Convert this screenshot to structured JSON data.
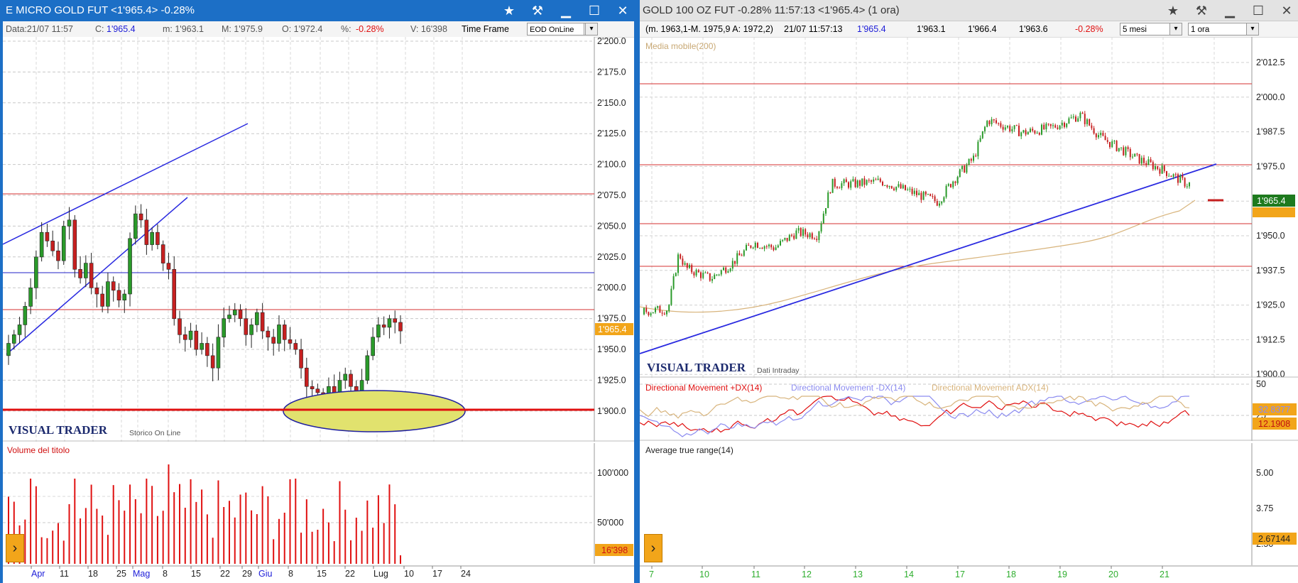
{
  "left": {
    "title": "E MICRO GOLD FUT <1'965.4> -0.28%",
    "info": {
      "data": "Data:21/07 11:57",
      "c_label": "C:",
      "c_value": "1'965.4",
      "m": "m: 1'963.1",
      "M": "M: 1'975.9",
      "O": "O: 1'972.4",
      "pct_label": "%:",
      "pct_value": "-0.28%",
      "V": "V: 16'398",
      "time_frame": "Time Frame",
      "mode": "EOD OnLine"
    },
    "price_ticks": [
      "2'200.0",
      "2'175.0",
      "2'150.0",
      "2'125.0",
      "2'100.0",
      "2'075.0",
      "2'050.0",
      "2'025.0",
      "2'000.0",
      "1'975.0",
      "1'950.0",
      "1'925.0",
      "1'900.0"
    ],
    "price_tag": "1'965.4",
    "logo": "VISUAL TRADER",
    "logo_sub": "Storico On Line",
    "volume_title": "Volume del titolo",
    "volume_ticks": [
      "100'000",
      "50'000"
    ],
    "volume_tag": "16'398",
    "date_labels": [
      "Apr",
      "11",
      "18",
      "25",
      "Mag",
      "8",
      "15",
      "22",
      "29",
      "Giu",
      "8",
      "15",
      "22",
      "Lug",
      "10",
      "17",
      "24"
    ]
  },
  "right": {
    "title": "GOLD 100 OZ FUT -0.28% 11:57:13  <1'965.4> (1 ora)",
    "info": {
      "range": "(m. 1963,1-M. 1975,9 A: 1972,2)",
      "datetime": "21/07 11:57:13",
      "last": "1'965.4",
      "low": "1'963.1",
      "high": "1'966.4",
      "open": "1'963.6",
      "pct": "-0.28%",
      "period": "5 mesi",
      "interval": "1 ora"
    },
    "ma_label": "Media mobile(200)",
    "price_ticks": [
      "2'012.5",
      "2'000.0",
      "1'987.5",
      "1'975.0",
      "1'962.5",
      "1'950.0",
      "1'937.5",
      "1'925.0",
      "1'912.5",
      "1'900.0"
    ],
    "price_tag": "1'965.4",
    "logo": "VISUAL TRADER",
    "logo_sub": "Dati Intraday",
    "dm_labels": [
      "Directional Movement +DX(14)",
      "Directional Movement -DX(14)",
      "Directional Movement ADX(14)"
    ],
    "dm_ticks": [
      "50",
      "25"
    ],
    "dm_tags": [
      "32.8377",
      "12.1908"
    ],
    "atr_label": "Average true range(14)",
    "atr_ticks": [
      "5.00",
      "3.75",
      "2.50"
    ],
    "atr_tag": "2.67144",
    "date_labels": [
      "7",
      "10",
      "11",
      "12",
      "13",
      "14",
      "17",
      "18",
      "19",
      "20",
      "21"
    ]
  },
  "colors": {
    "window_blue": "#1c6fc6",
    "candle_up": "#2a9a2a",
    "candle_down": "#c62020",
    "price_tag": "#f2a51a",
    "current_tag_green": "#1e7a1e",
    "volume_bar": "#e01010"
  }
}
